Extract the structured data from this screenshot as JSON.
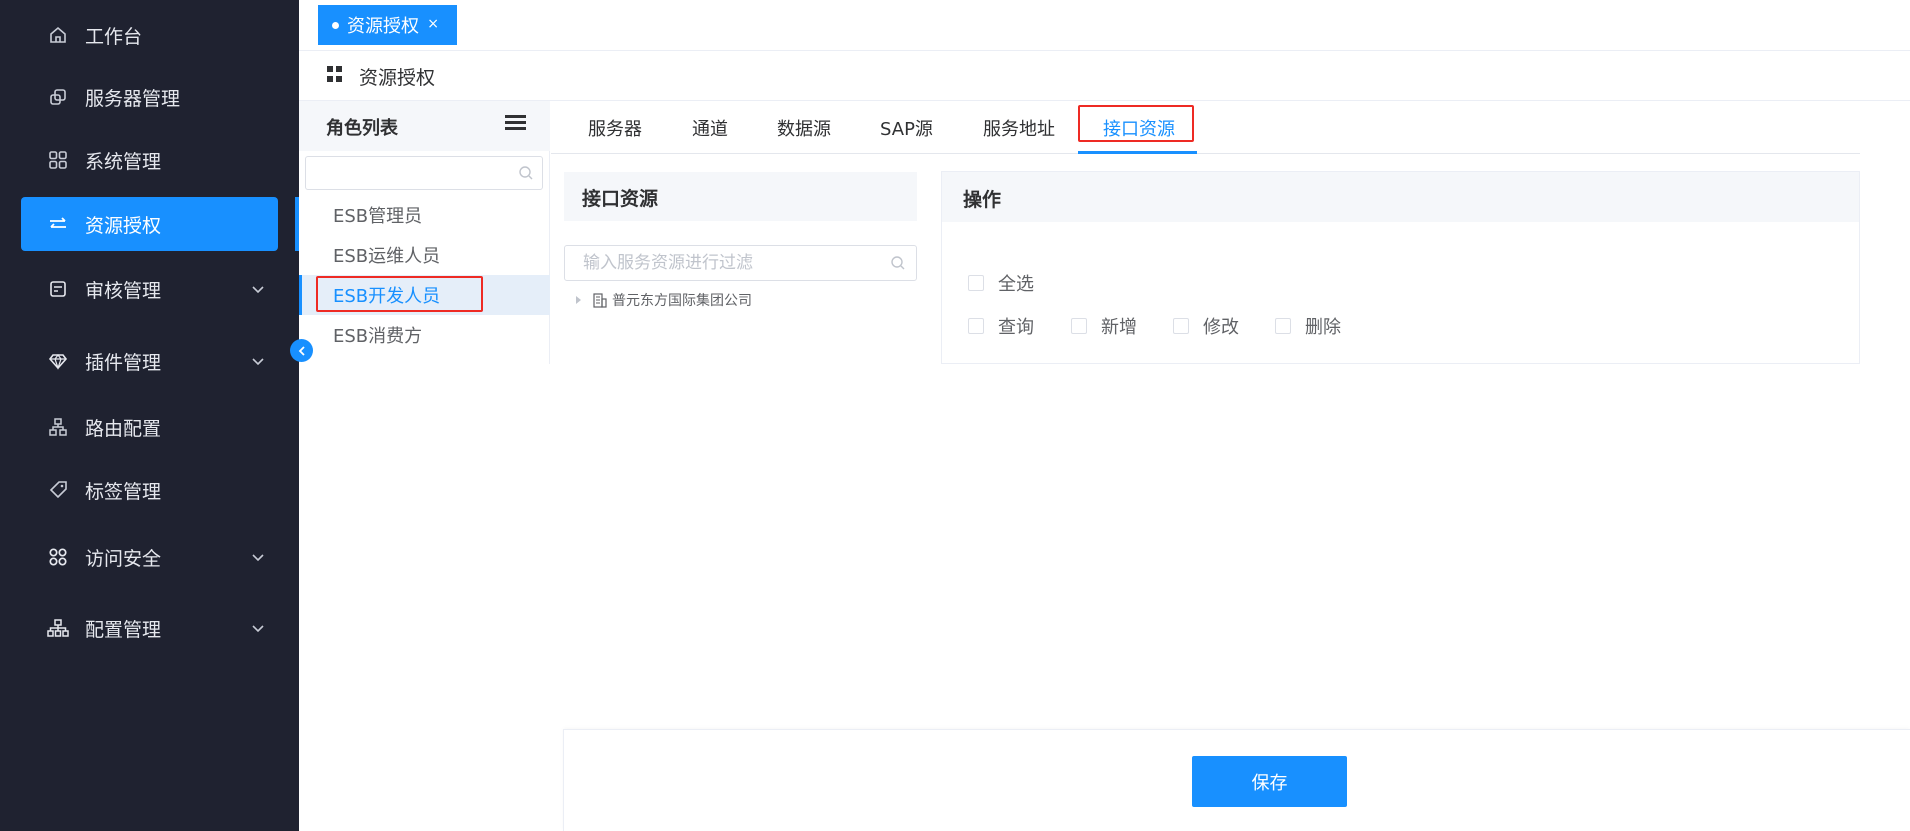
{
  "sidebar": {
    "items": [
      {
        "label": "工作台",
        "icon": "home-icon"
      },
      {
        "label": "服务器管理",
        "icon": "server-icon"
      },
      {
        "label": "系统管理",
        "icon": "apps-icon"
      },
      {
        "label": "资源授权",
        "icon": "swap-icon",
        "active": true
      },
      {
        "label": "审核管理",
        "icon": "audit-icon",
        "expandable": true
      },
      {
        "label": "插件管理",
        "icon": "diamond-icon",
        "expandable": true
      },
      {
        "label": "路由配置",
        "icon": "route-icon"
      },
      {
        "label": "标签管理",
        "icon": "tag-icon"
      },
      {
        "label": "访问安全",
        "icon": "security-icon",
        "expandable": true
      },
      {
        "label": "配置管理",
        "icon": "config-icon",
        "expandable": true
      }
    ]
  },
  "tagbar": {
    "tag_label": "资源授权",
    "close": "×"
  },
  "page": {
    "title": "资源授权"
  },
  "roles": {
    "title": "角色列表",
    "items": [
      "ESB管理员",
      "ESB运维人员",
      "ESB开发人员",
      "ESB消费方"
    ],
    "selected": "ESB开发人员"
  },
  "tabs": {
    "items": [
      "服务器",
      "通道",
      "数据源",
      "SAP源",
      "服务地址",
      "接口资源"
    ],
    "active": "接口资源"
  },
  "resource": {
    "title": "接口资源",
    "search_placeholder": "输入服务资源进行过滤",
    "tree_root": "普元东方国际集团公司"
  },
  "operations": {
    "title": "操作",
    "select_all": "全选",
    "options": [
      "查询",
      "新增",
      "修改",
      "删除"
    ]
  },
  "footer": {
    "save_label": "保存"
  },
  "colors": {
    "accent": "#1890ff",
    "sidebar_bg": "#1f2230",
    "highlight": "#ee2a24"
  }
}
